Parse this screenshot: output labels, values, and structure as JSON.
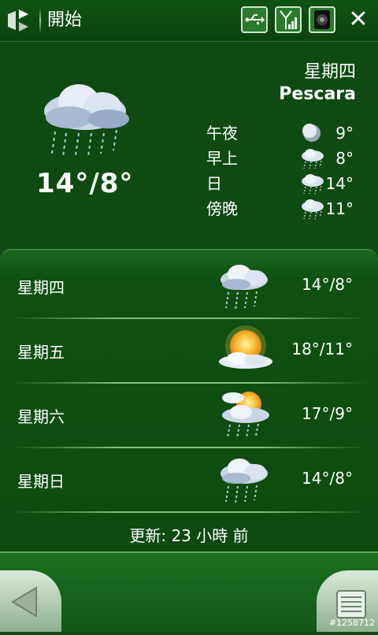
{
  "app": {
    "title": "開始"
  },
  "today": {
    "day": "星期四",
    "city": "Pescara",
    "temp": "14°/8°",
    "icon": "cloud-rain-icon",
    "periods": [
      {
        "label": "午夜",
        "temp": "9°",
        "icon": "moon-icon"
      },
      {
        "label": "早上",
        "temp": "8°",
        "icon": "cloud-rain-small-icon"
      },
      {
        "label": "日",
        "temp": "14°",
        "icon": "cloud-rain-small-icon"
      },
      {
        "label": "傍晚",
        "temp": "11°",
        "icon": "cloud-rain-small-icon"
      }
    ]
  },
  "forecast": [
    {
      "day": "星期四",
      "temp": "14°/8°",
      "icon": "cloud-rain-icon"
    },
    {
      "day": "星期五",
      "temp": "18°/11°",
      "icon": "sun-cloud-icon"
    },
    {
      "day": "星期六",
      "temp": "17°/9°",
      "icon": "sun-cloud-rain-icon"
    },
    {
      "day": "星期日",
      "temp": "14°/8°",
      "icon": "cloud-rain-icon"
    }
  ],
  "updated": "更新: 23 小時 前",
  "watermark": "#1258712",
  "colors": {
    "background": "#0f4a12",
    "accent": "#7ac47c"
  }
}
